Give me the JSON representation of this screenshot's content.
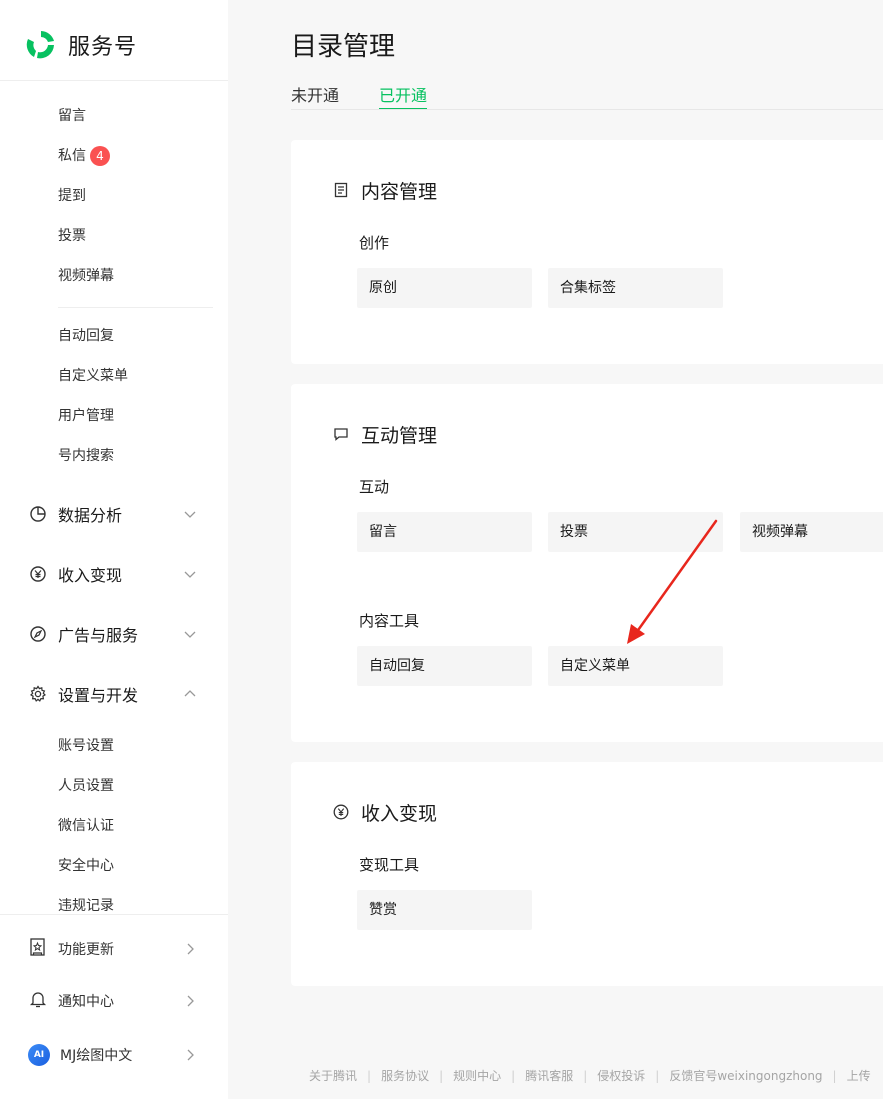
{
  "brand": {
    "name": "服务号"
  },
  "sidebar": {
    "sub_items_top": [
      {
        "label": "留言"
      },
      {
        "label": "私信",
        "badge": "4"
      },
      {
        "label": "提到"
      },
      {
        "label": "投票"
      },
      {
        "label": "视频弹幕"
      }
    ],
    "sub_items_mid": [
      {
        "label": "自动回复"
      },
      {
        "label": "自定义菜单"
      },
      {
        "label": "用户管理"
      },
      {
        "label": "号内搜索"
      }
    ],
    "groups": [
      {
        "label": "数据分析",
        "icon": "pie-chart-icon",
        "state": "collapsed"
      },
      {
        "label": "收入变现",
        "icon": "yen-icon",
        "state": "collapsed"
      },
      {
        "label": "广告与服务",
        "icon": "compass-icon",
        "state": "collapsed"
      },
      {
        "label": "设置与开发",
        "icon": "gear-icon",
        "state": "expanded"
      }
    ],
    "settings_items": [
      {
        "label": "账号设置"
      },
      {
        "label": "人员设置"
      },
      {
        "label": "微信认证"
      },
      {
        "label": "安全中心"
      },
      {
        "label": "违规记录"
      }
    ],
    "bottom": [
      {
        "label": "功能更新",
        "icon": "update-icon"
      },
      {
        "label": "通知中心",
        "icon": "bell-icon"
      },
      {
        "label": "MJ绘图中文",
        "icon": "avatar",
        "avatar_text": "AI"
      }
    ]
  },
  "main": {
    "title": "目录管理",
    "tabs": [
      {
        "label": "未开通",
        "active": false
      },
      {
        "label": "已开通",
        "active": true
      }
    ],
    "cards": [
      {
        "title": "内容管理",
        "icon": "document-icon",
        "sections": [
          {
            "label": "创作",
            "tiles": [
              "原创",
              "合集标签"
            ]
          }
        ]
      },
      {
        "title": "互动管理",
        "icon": "chat-icon",
        "sections": [
          {
            "label": "互动",
            "tiles": [
              "留言",
              "投票",
              "视频弹幕"
            ]
          },
          {
            "label": "内容工具",
            "tiles": [
              "自动回复",
              "自定义菜单"
            ]
          }
        ]
      },
      {
        "title": "收入变现",
        "icon": "yen-icon",
        "sections": [
          {
            "label": "变现工具",
            "tiles": [
              "赞赏"
            ]
          }
        ]
      }
    ]
  },
  "footer": {
    "links": [
      "关于腾讯",
      "服务协议",
      "规则中心",
      "腾讯客服",
      "侵权投诉",
      "反馈官号weixingongzhong",
      "上传"
    ]
  },
  "colors": {
    "accent": "#07c160",
    "badge": "#fa5151",
    "annotation_arrow": "#e8271d"
  }
}
